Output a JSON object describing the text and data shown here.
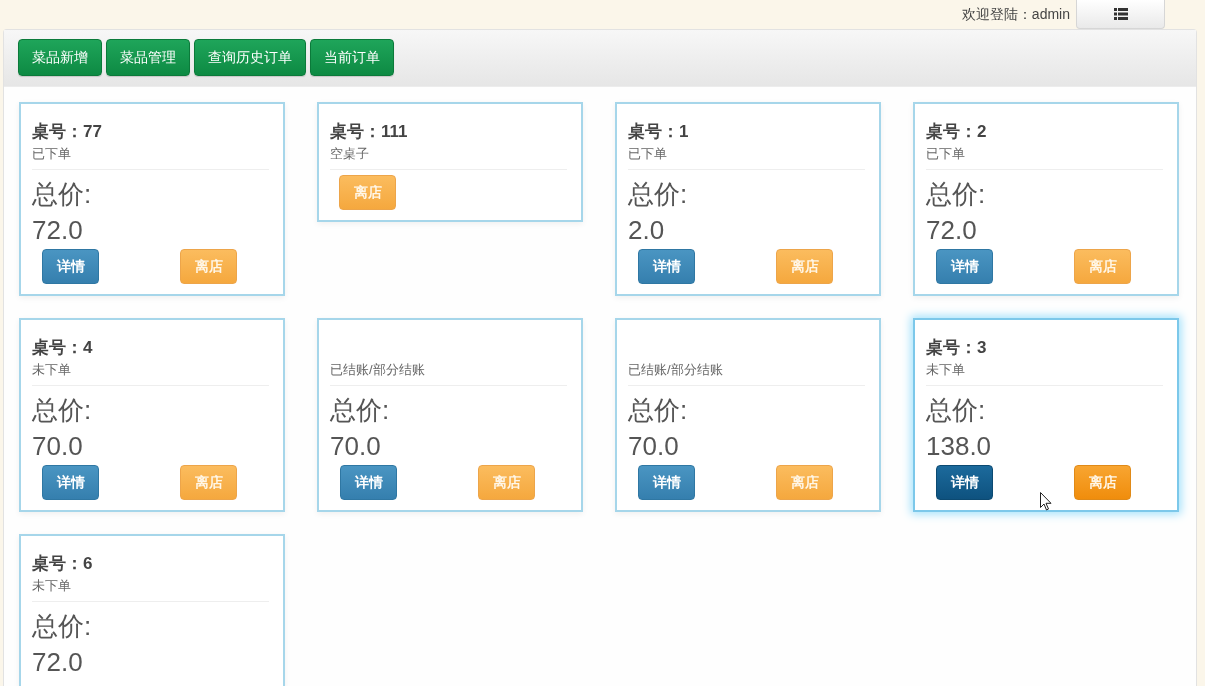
{
  "header": {
    "welcome": "欢迎登陆：admin"
  },
  "toolbar": {
    "buttons": [
      "菜品新增",
      "菜品管理",
      "查询历史订单",
      "当前订单"
    ]
  },
  "tables": [
    {
      "kind": "occupied",
      "title": "桌号：77",
      "status": "已下单",
      "total_label": "总价:",
      "total": "72.0",
      "buttons": [
        {
          "kind": "details",
          "label": "详情"
        },
        {
          "kind": "leave",
          "label": "离店"
        }
      ],
      "selected": false
    },
    {
      "kind": "empty",
      "title": "桌号：111",
      "status": "空桌子",
      "buttons": [
        {
          "kind": "leave",
          "label": "离店"
        }
      ],
      "selected": false
    },
    {
      "kind": "occupied",
      "title": "桌号：1",
      "status": "已下单",
      "total_label": "总价:",
      "total": "2.0",
      "buttons": [
        {
          "kind": "details",
          "label": "详情"
        },
        {
          "kind": "leave",
          "label": "离店"
        }
      ],
      "selected": false
    },
    {
      "kind": "occupied",
      "title": "桌号：2",
      "status": "已下单",
      "total_label": "总价:",
      "total": "72.0",
      "buttons": [
        {
          "kind": "details",
          "label": "详情"
        },
        {
          "kind": "leave",
          "label": "离店"
        }
      ],
      "selected": false
    },
    {
      "kind": "occupied",
      "title": "桌号：4",
      "status": "未下单",
      "total_label": "总价:",
      "total": "70.0",
      "buttons": [
        {
          "kind": "details",
          "label": "详情"
        },
        {
          "kind": "leave",
          "label": "离店"
        }
      ],
      "selected": false
    },
    {
      "kind": "occupied",
      "status": "已结账/部分结账",
      "total_label": "总价:",
      "total": "70.0",
      "buttons": [
        {
          "kind": "details",
          "label": "详情"
        },
        {
          "kind": "leave",
          "label": "离店"
        }
      ],
      "selected": false
    },
    {
      "kind": "occupied",
      "status": "已结账/部分结账",
      "total_label": "总价:",
      "total": "70.0",
      "buttons": [
        {
          "kind": "details",
          "label": "详情"
        },
        {
          "kind": "leave",
          "label": "离店"
        }
      ],
      "selected": false
    },
    {
      "kind": "occupied",
      "title": "桌号：3",
      "status": "未下单",
      "total_label": "总价:",
      "total": "138.0",
      "buttons": [
        {
          "kind": "details",
          "label": "详情"
        },
        {
          "kind": "leave",
          "label": "离店"
        }
      ],
      "selected": true
    },
    {
      "kind": "occupied",
      "title": "桌号：6",
      "status": "未下单",
      "total_label": "总价:",
      "total": "72.0",
      "selected": false
    }
  ]
}
